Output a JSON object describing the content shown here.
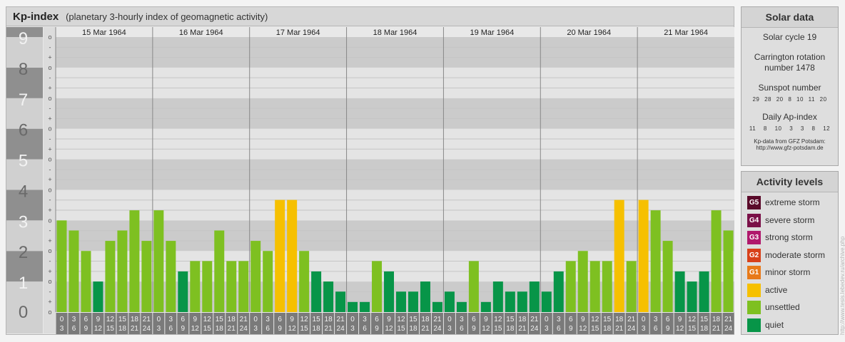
{
  "header": {
    "title": "Kp-index",
    "subtitle": "(planetary 3-hourly index of geomagnetic activity)"
  },
  "solar": {
    "title": "Solar data",
    "cycle": "Solar cycle 19",
    "carrington_line1": "Carrington rotation",
    "carrington_line2": "number 1478",
    "sunspot_label": "Sunspot number",
    "sunspot_values": "29 28 20 8 10 11 20",
    "ap_label": "Daily Ap-index",
    "ap_values": "11 8 10 3 3 8 12",
    "source_line1": "Kp-data from GFZ Potsdam:",
    "source_line2": "http://www.gfz-potsdam.de"
  },
  "activity": {
    "title": "Activity levels",
    "levels": [
      {
        "badge": "G5",
        "label": "extreme storm",
        "color": "#5a0a2a"
      },
      {
        "badge": "G4",
        "label": "severe storm",
        "color": "#7a1048"
      },
      {
        "badge": "G3",
        "label": "strong storm",
        "color": "#b0186c"
      },
      {
        "badge": "G2",
        "label": "moderate storm",
        "color": "#d8401a"
      },
      {
        "badge": "G1",
        "label": "minor storm",
        "color": "#e87a1a"
      },
      {
        "badge": "",
        "label": "active",
        "color": "#f6c000"
      },
      {
        "badge": "",
        "label": "unsettled",
        "color": "#7ec021"
      },
      {
        "badge": "",
        "label": "quiet",
        "color": "#079548"
      }
    ]
  },
  "watermark": "http://www.tesis.lebedev.ru/archive.php",
  "chart_data": {
    "type": "bar",
    "ylim": [
      0,
      9
    ],
    "yticks": [
      "0",
      "1",
      "2",
      "3",
      "4",
      "5",
      "6",
      "7",
      "8",
      "9"
    ],
    "minor_marks": [
      "o",
      "+",
      "-"
    ],
    "days": [
      "15 Mar 1964",
      "16 Mar 1964",
      "17 Mar 1964",
      "18 Mar 1964",
      "19 Mar 1964",
      "20 Mar 1964",
      "21 Mar 1964"
    ],
    "interval_start": [
      "0",
      "3",
      "6",
      "9",
      "12",
      "15",
      "18",
      "21"
    ],
    "interval_end": [
      "3",
      "6",
      "9",
      "12",
      "15",
      "18",
      "21",
      "24"
    ],
    "kp_values": [
      [
        3.0,
        2.67,
        2.0,
        1.0,
        2.33,
        2.67,
        3.33,
        2.33
      ],
      [
        3.33,
        2.33,
        1.33,
        1.67,
        1.67,
        2.67,
        1.67,
        1.67
      ],
      [
        2.33,
        2.0,
        3.67,
        3.67,
        2.0,
        1.33,
        1.0,
        0.67
      ],
      [
        0.33,
        0.33,
        1.67,
        1.33,
        0.67,
        0.67,
        1.0,
        0.33
      ],
      [
        0.67,
        0.33,
        1.67,
        0.33,
        1.0,
        0.67,
        0.67,
        1.0
      ],
      [
        0.67,
        1.33,
        1.67,
        2.0,
        1.67,
        1.67,
        3.67,
        1.67
      ],
      [
        3.67,
        3.33,
        2.33,
        1.33,
        1.0,
        1.33,
        3.33,
        2.67
      ]
    ],
    "colors": {
      "quiet": "#079548",
      "unsettled": "#7ec021",
      "active": "#f6c000",
      "band_dark": "#cbcbcb",
      "band_light": "#e4e4e4",
      "ytick_band": "#8f8f8f",
      "xtick_box": "#7a7a7a"
    }
  }
}
